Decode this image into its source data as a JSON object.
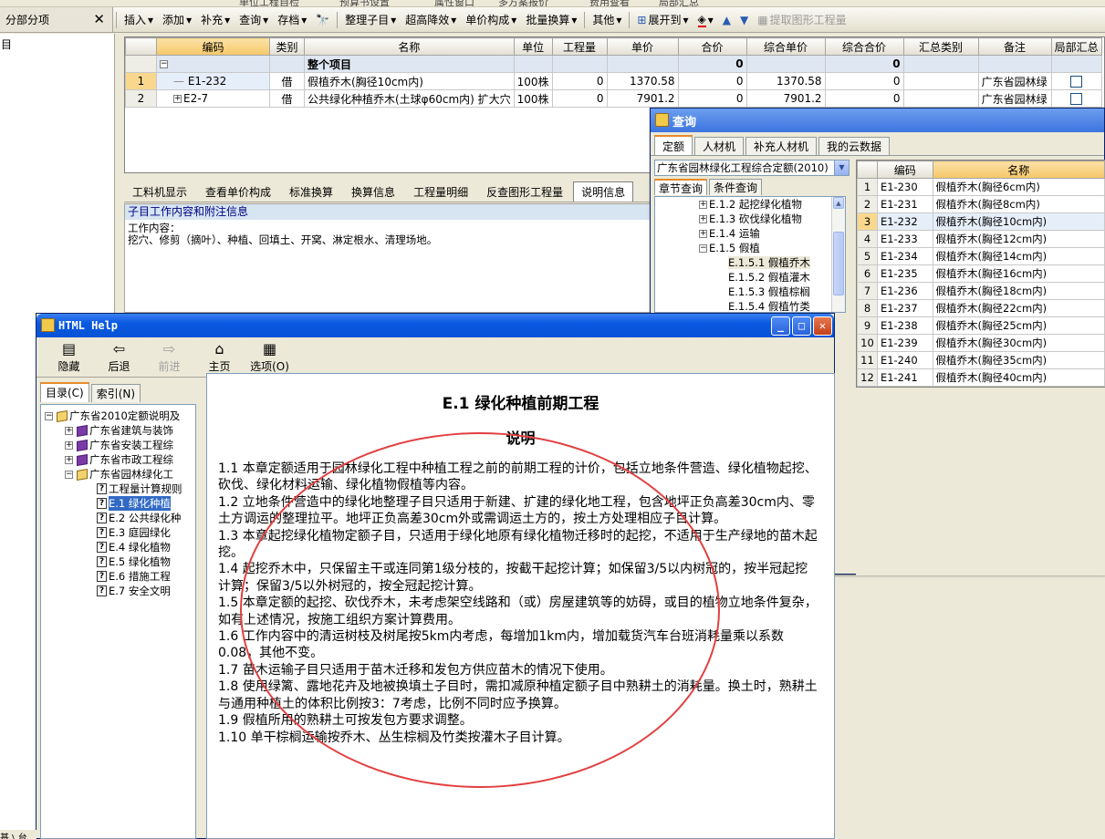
{
  "top_partial": [
    "单位工程自检",
    "预算书设置",
    "属性窗口",
    "多方案报价",
    "费用查看",
    "局部汇总"
  ],
  "left_panel": {
    "title": "分部分项",
    "close": "✕",
    "tree_root": "目"
  },
  "toolbar": {
    "items": [
      "插入",
      "添加",
      "补充",
      "查询",
      "存档",
      "整理子目",
      "超高降效",
      "单价构成",
      "批量换算",
      "其他",
      "展开到",
      "提取图形工程量"
    ]
  },
  "grid": {
    "headers": [
      "编码",
      "类别",
      "名称",
      "单位",
      "工程量",
      "单价",
      "合价",
      "综合单价",
      "综合合价",
      "汇总类别",
      "备注",
      "局部汇总"
    ],
    "group_row": {
      "name": "整个项目",
      "hejia": "0",
      "zonghe_hejia": "0"
    },
    "rows": [
      {
        "no": "1",
        "code": "E1-232",
        "type": "借",
        "name": "假植乔木(胸径10cm内)",
        "unit": "100株",
        "qty": "0",
        "price": "1370.58",
        "total": "0",
        "uprice": "1370.58",
        "utotal": "0",
        "note": "广东省园林绿"
      },
      {
        "no": "2",
        "code": "E2-7",
        "type": "借",
        "name": "公共绿化种植乔木(土球φ60cm内) 扩大穴",
        "unit": "100株",
        "qty": "0",
        "price": "7901.2",
        "total": "0",
        "uprice": "7901.2",
        "utotal": "0",
        "note": "广东省园林绿"
      }
    ]
  },
  "bottom_tabs": [
    "工料机显示",
    "查看单价构成",
    "标准换算",
    "换算信息",
    "工程量明细",
    "反查图形工程量",
    "说明信息"
  ],
  "desc": {
    "header": "子目工作内容和附注信息",
    "body": "工作内容：\n挖穴、修剪（摘叶）、种植、回填土、开窝、淋定根水、清理场地。"
  },
  "query": {
    "title": "查询",
    "tabs": [
      "定额",
      "人材机",
      "补充人材机",
      "我的云数据"
    ],
    "library": "广东省园林绿化工程综合定额(2010)",
    "subtabs": [
      "章节查询",
      "条件查询"
    ],
    "tree": [
      {
        "label": "E.1.2 起挖绿化植物",
        "indent": 1
      },
      {
        "label": "E.1.3 砍伐绿化植物",
        "indent": 1
      },
      {
        "label": "E.1.4 运输",
        "indent": 1
      },
      {
        "label": "E.1.5 假植",
        "indent": 1
      },
      {
        "label": "E.1.5.1 假植乔木",
        "indent": 2
      },
      {
        "label": "E.1.5.2 假植灌木",
        "indent": 2
      },
      {
        "label": "E.1.5.3 假植棕榈",
        "indent": 2
      },
      {
        "label": "E.1.5.4 假植竹类",
        "indent": 2
      }
    ],
    "grid_headers": [
      "编码",
      "名称"
    ],
    "grid_rows": [
      [
        "1",
        "E1-230",
        "假植乔木(胸径6cm内)"
      ],
      [
        "2",
        "E1-231",
        "假植乔木(胸径8cm内)"
      ],
      [
        "3",
        "E1-232",
        "假植乔木(胸径10cm内)"
      ],
      [
        "4",
        "E1-233",
        "假植乔木(胸径12cm内)"
      ],
      [
        "5",
        "E1-234",
        "假植乔木(胸径14cm内)"
      ],
      [
        "6",
        "E1-235",
        "假植乔木(胸径16cm内)"
      ],
      [
        "7",
        "E1-236",
        "假植乔木(胸径18cm内)"
      ],
      [
        "8",
        "E1-237",
        "假植乔木(胸径22cm内)"
      ],
      [
        "9",
        "E1-238",
        "假植乔木(胸径25cm内)"
      ],
      [
        "10",
        "E1-239",
        "假植乔木(胸径30cm内)"
      ],
      [
        "11",
        "E1-240",
        "假植乔木(胸径35cm内)"
      ],
      [
        "12",
        "E1-241",
        "假植乔木(胸径40cm内)"
      ]
    ]
  },
  "help": {
    "title": "HTML Help",
    "toolbar": [
      "隐藏",
      "后退",
      "前进",
      "主页",
      "选项(O)"
    ],
    "tabs": [
      "目录(C)",
      "索引(N)"
    ],
    "tree": [
      {
        "label": "广东省2010定额说明及",
        "kind": "open",
        "indent": 0,
        "exp": "-"
      },
      {
        "label": "广东省建筑与装饰",
        "kind": "book",
        "indent": 1,
        "exp": "+"
      },
      {
        "label": "广东省安装工程综",
        "kind": "book",
        "indent": 1,
        "exp": "+"
      },
      {
        "label": "广东省市政工程综",
        "kind": "book",
        "indent": 1,
        "exp": "+"
      },
      {
        "label": "广东省园林绿化工",
        "kind": "open",
        "indent": 1,
        "exp": "-"
      },
      {
        "label": "工程量计算规则",
        "kind": "page",
        "indent": 2,
        "exp": ""
      },
      {
        "label": "E.1  绿化种植",
        "kind": "page",
        "indent": 2,
        "exp": "",
        "sel": true
      },
      {
        "label": "E.2 公共绿化种",
        "kind": "page",
        "indent": 2,
        "exp": ""
      },
      {
        "label": "E.3  庭园绿化",
        "kind": "page",
        "indent": 2,
        "exp": ""
      },
      {
        "label": "E.4  绿化植物",
        "kind": "page",
        "indent": 2,
        "exp": ""
      },
      {
        "label": "E.5  绿化植物",
        "kind": "page",
        "indent": 2,
        "exp": ""
      },
      {
        "label": "E.6  措施工程",
        "kind": "page",
        "indent": 2,
        "exp": ""
      },
      {
        "label": "E.7  安全文明",
        "kind": "page",
        "indent": 2,
        "exp": ""
      }
    ],
    "doc_title": "E.1   绿化种植前期工程",
    "doc_subtitle": "说明",
    "paragraphs": [
      "1.1   本章定额适用于园林绿化工程中种植工程之前的前期工程的计价，包括立地条件营造、绿化植物起挖、砍伐、绿化材料运输、绿化植物假植等内容。",
      "1.2   立地条件营造中的绿化地整理子目只适用于新建、扩建的绿化地工程，包含地坪正负高差30cm内、零土方调运的整理拉平。地坪正负高差30cm外或需调运土方的，按土方处理相应子目计算。",
      "1.3   本章起挖绿化植物定额子目，只适用于绿化地原有绿化植物迁移时的起挖，不适用于生产绿地的苗木起挖。",
      "1.4   起挖乔木中，只保留主干或连同第1级分枝的，按截干起挖计算；如保留3/5以内树冠的，按半冠起挖计算；保留3/5以外树冠的，按全冠起挖计算。",
      "1.5   本章定额的起挖、砍伐乔木，未考虑架空线路和（或）房屋建筑等的妨碍，或目的植物立地条件复杂，如有上述情况，按施工组织方案计算费用。",
      "1.6   工作内容中的清运树枝及树尾按5km内考虑，每增加1km内，增加载货汽车台班消耗量乘以系数0.08，其他不变。",
      "1.7   苗木运输子目只适用于苗木迁移和发包方供应苗木的情况下使用。",
      "1.8   使用绿篱、露地花卉及地被换填土子目时，需扣减原种植定额子目中熟耕土的消耗量。换土时，熟耕土与通用种植土的体积比例按3：7考虑，比例不同时应予换算。",
      "1.9   假植所用的熟耕土可按发包方要求调整。",
      "1.10   单干棕榈运输按乔木、丛生棕榈及竹类按灌木子目计算。"
    ]
  },
  "bottom_left_text": "基 \\ 台"
}
